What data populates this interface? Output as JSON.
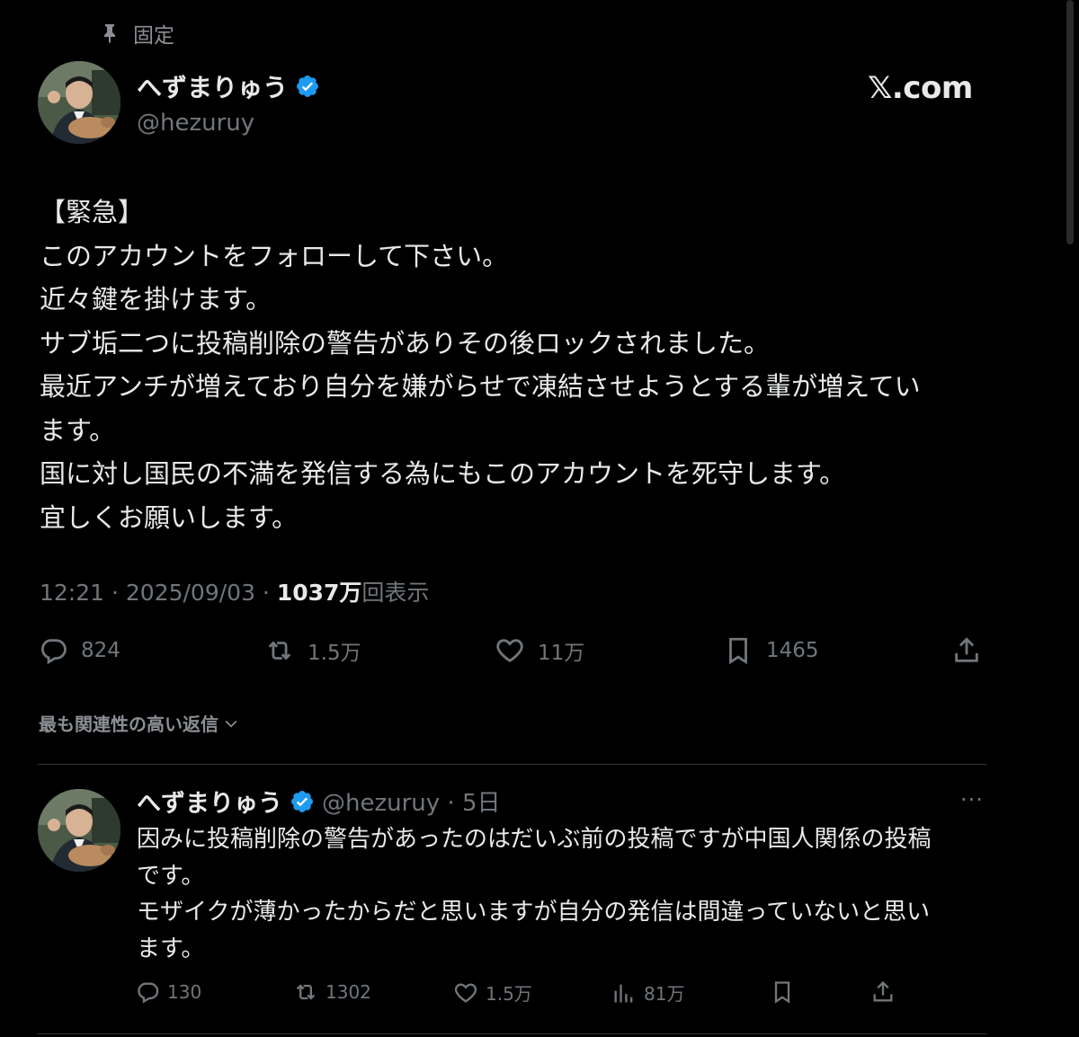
{
  "pinned": {
    "label": "固定"
  },
  "tweet": {
    "author_name": "へずまりゅう",
    "author_handle": "@hezuruy",
    "watermark": "𝕏.com",
    "text": "【緊急】\nこのアカウントをフォローして下さい。\n近々鍵を掛けます。\nサブ垢二つに投稿削除の警告がありその後ロックされました。\n最近アンチが増えており自分を嫌がらせで凍結させようとする輩が増えてい\nます。\n国に対し国民の不満を発信する為にもこのアカウントを死守します。\n宜しくお願いします。",
    "time": "12:21 · 2025/09/03 · ",
    "views": "1037万",
    "views_suffix": "回表示",
    "replies": "824",
    "reposts": "1.5万",
    "likes": "11万",
    "bookmarks": "1465"
  },
  "sort": {
    "label": "最も関連性の高い返信"
  },
  "reply": {
    "author_name": "へずまりゅう",
    "handle_time": "@hezuruy · 5日",
    "more": "···",
    "text": "因みに投稿削除の警告があったのはだいぶ前の投稿ですが中国人関係の投稿\nです。\nモザイクが薄かったからだと思いますが自分の発信は間違っていないと思い\nます。",
    "replies": "130",
    "reposts": "1302",
    "likes": "1.5万",
    "views": "81万"
  },
  "colors": {
    "background": "#000000",
    "text": "#e7e9ea",
    "muted": "#71767b",
    "verified": "#1d9bf0"
  }
}
